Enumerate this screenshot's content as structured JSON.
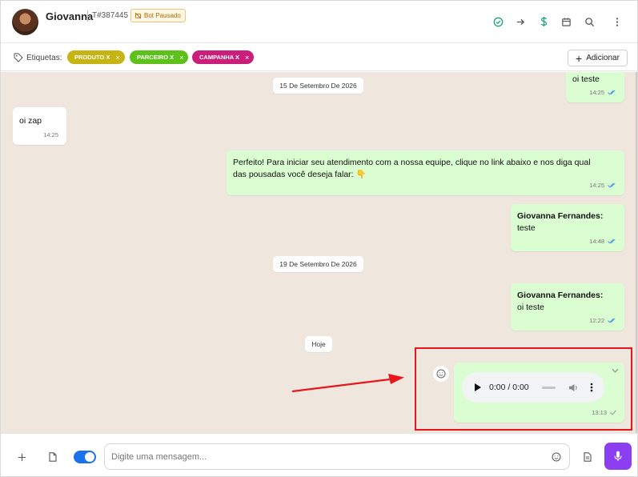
{
  "header": {
    "contact_name": "Giovanna",
    "ticket": "T#387445",
    "bot_status": "Bot Pausado",
    "icons": [
      "check-circle-icon",
      "arrow-right-icon",
      "dollar-icon",
      "calendar-icon",
      "search-icon",
      "more-vertical-icon"
    ]
  },
  "tags": {
    "label": "Etiquetas:",
    "items": [
      {
        "label": "PRODUTO X",
        "color": "#c6b413"
      },
      {
        "label": "PARCEIRO X",
        "color": "#5ec11b"
      },
      {
        "label": "CAMPANHA X",
        "color": "#c91f7a"
      }
    ],
    "remove_symbol": "×",
    "add_label": "Adicionar"
  },
  "chat": {
    "dates": [
      "15 De Setembro De 2026",
      "19 De Setembro De 2026",
      "Hoje"
    ],
    "messages": [
      {
        "direction": "out",
        "text": "oi teste",
        "time": "14:25",
        "status": "read"
      },
      {
        "direction": "in",
        "text": "oi zap",
        "time": "14:25"
      },
      {
        "direction": "out",
        "text": "Perfeito! Para iniciar seu atendimento com a nossa equipe, clique no link abaixo e nos diga qual das pousadas você deseja falar: 👇",
        "time": "14:25",
        "status": "read"
      },
      {
        "direction": "out",
        "sender": "Giovanna Fernandes:",
        "text": "teste",
        "time": "14:48",
        "status": "read"
      },
      {
        "direction": "out",
        "sender": "Giovanna Fernandes:",
        "text": "oi teste",
        "time": "12:22",
        "status": "read"
      },
      {
        "direction": "out",
        "type": "audio",
        "audio_time": "0:00 / 0:00",
        "time": "13:13",
        "status": "sent"
      }
    ]
  },
  "composer": {
    "placeholder": "Digite uma mensagem...",
    "accent": "#8b3ff0",
    "toggle_on": true
  },
  "colors": {
    "chat_bg": "#efe7de",
    "out_bubble": "#dbfdd2",
    "read_tick": "#4a9be0",
    "highlight": "#e8161c"
  }
}
